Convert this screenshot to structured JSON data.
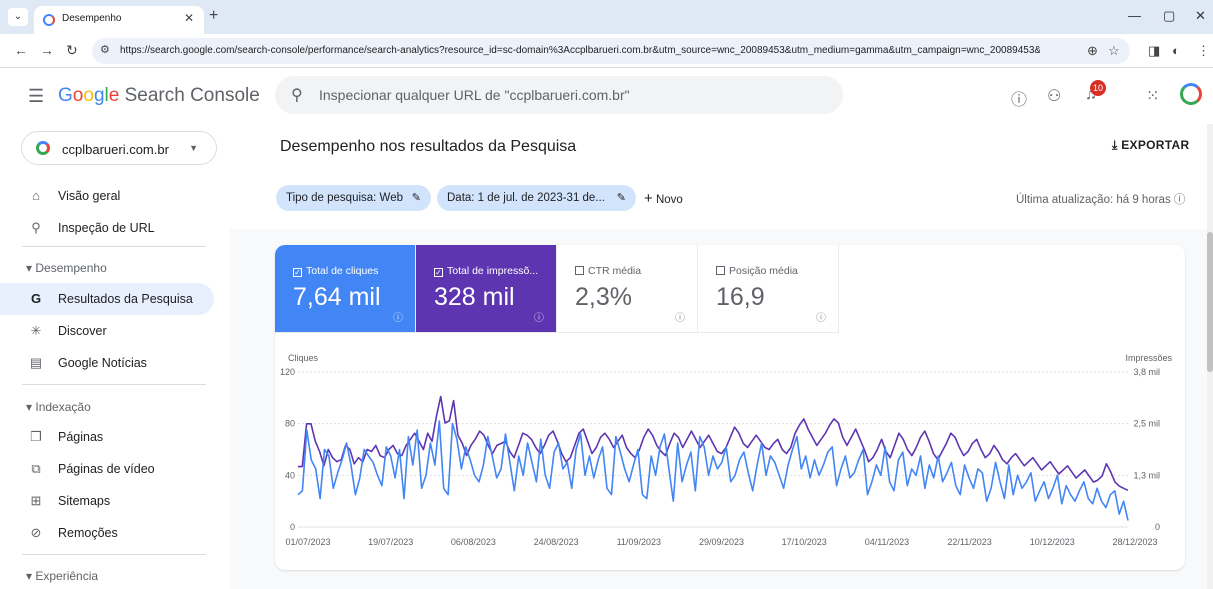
{
  "browser": {
    "tab_title": "Desempenho",
    "url": "https://search.google.com/search-console/performance/search-analytics?resource_id=sc-domain%3Accplbarueri.com.br&utm_source=wnc_20089453&utm_medium=gamma&utm_campaign=wnc_20089453&utm_co...",
    "icons": [
      "tab-list-icon",
      "close-icon",
      "plus-icon",
      "back-icon",
      "forward-icon",
      "reload-icon",
      "site-settings-icon",
      "zoom-icon",
      "star-icon",
      "sidepanel-icon",
      "extension-icon",
      "menu-icon",
      "minimize-icon",
      "maximize-icon",
      "close-window-icon"
    ]
  },
  "header": {
    "logo_google": [
      "G",
      "o",
      "o",
      "g",
      "l",
      "e"
    ],
    "logo_product": "Search Console",
    "search_placeholder": "Inspecionar qualquer URL de \"ccplbarueri.com.br\"",
    "notification_count": "10"
  },
  "sidebar": {
    "property": "ccplbarueri.com.br",
    "overview": "Visão geral",
    "url_inspection": "Inspeção de URL",
    "section_performance": "Desempenho",
    "items_performance": [
      "Resultados da Pesquisa",
      "Discover",
      "Google Notícias"
    ],
    "section_indexing": "Indexação",
    "items_indexing": [
      "Páginas",
      "Páginas de vídeo",
      "Sitemaps",
      "Remoções"
    ],
    "section_experience": "Experiência"
  },
  "main": {
    "title": "Desempenho nos resultados da Pesquisa",
    "export": "EXPORTAR",
    "filter_search_type": "Tipo de pesquisa: Web",
    "filter_date": "Data: 1 de jul. de 2023-31 de...",
    "new_filter": "Novo",
    "last_update": "Última atualização: há 9 horas"
  },
  "metrics": [
    {
      "label": "Total de cliques",
      "value": "7,64 mil",
      "selected": true,
      "color": "#4285f4"
    },
    {
      "label": "Total de impressõ...",
      "value": "328 mil",
      "selected": true,
      "color": "#5e35b1"
    },
    {
      "label": "CTR média",
      "value": "2,3%",
      "selected": false,
      "color": "#ffffff"
    },
    {
      "label": "Posição média",
      "value": "16,9",
      "selected": false,
      "color": "#ffffff"
    }
  ],
  "chart_data": {
    "type": "line",
    "ylabel_left": "Cliques",
    "ylabel_right": "Impressões",
    "yticks_left": [
      "120",
      "80",
      "40",
      "0"
    ],
    "yticks_right": [
      "3,8 mil",
      "2,5 mil",
      "1,3 mil",
      "0"
    ],
    "ylim_left": [
      0,
      120
    ],
    "ylim_right": [
      0,
      3800
    ],
    "x_tick_labels": [
      "01/07/2023",
      "19/07/2023",
      "06/08/2023",
      "24/08/2023",
      "11/09/2023",
      "29/09/2023",
      "17/10/2023",
      "04/11/2023",
      "22/11/2023",
      "10/12/2023",
      "28/12/2023"
    ],
    "grid": true,
    "series": [
      {
        "name": "Total de cliques",
        "color": "#4285f4",
        "axis": "left",
        "values": [
          25,
          28,
          75,
          52,
          45,
          22,
          60,
          55,
          30,
          42,
          52,
          65,
          48,
          25,
          38,
          60,
          55,
          50,
          40,
          32,
          62,
          55,
          38,
          60,
          22,
          70,
          48,
          75,
          30,
          40,
          65,
          48,
          82,
          30,
          25,
          80,
          68,
          45,
          62,
          52,
          40,
          35,
          48,
          70,
          55,
          38,
          45,
          72,
          50,
          28,
          55,
          40,
          65,
          50,
          35,
          68,
          40,
          30,
          58,
          65,
          45,
          50,
          30,
          60,
          72,
          40,
          55,
          38,
          52,
          62,
          30,
          25,
          70,
          58,
          45,
          35,
          48,
          60,
          25,
          22,
          55,
          40,
          62,
          72,
          45,
          20,
          65,
          35,
          48,
          58,
          28,
          70,
          62,
          40,
          55,
          45,
          50,
          62,
          35,
          40,
          52,
          58,
          42,
          28,
          48,
          65,
          40,
          55,
          50,
          40,
          30,
          48,
          60,
          70,
          45,
          55,
          38,
          52,
          40,
          48,
          58,
          62,
          32,
          45,
          55,
          38,
          42,
          52,
          60,
          25,
          35,
          48,
          40,
          62,
          35,
          28,
          52,
          58,
          32,
          45,
          40,
          55,
          30,
          48,
          38,
          55,
          35,
          42,
          50,
          32,
          25,
          48,
          38,
          30,
          45,
          42,
          20,
          30,
          50,
          35,
          22,
          48,
          25,
          40,
          30,
          35,
          42,
          20,
          28,
          35,
          22,
          30,
          40,
          18,
          32,
          25,
          20,
          28,
          35,
          22,
          18,
          30,
          20,
          15,
          25,
          28,
          10,
          20,
          5
        ]
      },
      {
        "name": "Total de impressões",
        "color": "#5e35b1",
        "axis": "right",
        "values": [
          1480,
          1480,
          2530,
          2530,
          2100,
          1850,
          1500,
          1900,
          1700,
          1600,
          1650,
          2000,
          1900,
          1550,
          1700,
          1600,
          1900,
          1850,
          2000,
          1750,
          1700,
          1900,
          2000,
          1800,
          1750,
          2000,
          2150,
          2300,
          2100,
          1900,
          2300,
          2100,
          2700,
          3200,
          2550,
          2600,
          3100,
          2250,
          2050,
          1750,
          2000,
          2150,
          2350,
          2250,
          2000,
          1800,
          2000,
          2050,
          2100,
          1850,
          1700,
          2000,
          2300,
          2250,
          2150,
          1950,
          1800,
          2000,
          2250,
          2350,
          2100,
          1800,
          1600,
          1700,
          2000,
          2300,
          2400,
          2100,
          1800,
          1950,
          2200,
          2300,
          2150,
          1950,
          2100,
          2250,
          1950,
          1800,
          1700,
          1900,
          2200,
          2400,
          2250,
          2000,
          1850,
          1750,
          2050,
          2300,
          2200,
          1950,
          2150,
          2350,
          2150,
          1950,
          2100,
          2250,
          2050,
          1850,
          1800,
          1950,
          2200,
          2450,
          2300,
          2050,
          1950,
          2100,
          2250,
          2100,
          1950,
          1900,
          2050,
          2150,
          1900,
          1800,
          1950,
          2300,
          2500,
          2650,
          2400,
          2200,
          2000,
          2150,
          2300,
          2500,
          2650,
          2550,
          2200,
          2000,
          2200,
          2400,
          2150,
          1900,
          1600,
          1700,
          1900,
          2150,
          1850,
          1700,
          2000,
          2300,
          2150,
          1900,
          1750,
          1950,
          2200,
          2350,
          2100,
          1800,
          1650,
          1850,
          2050,
          2300,
          2200,
          1950,
          1750,
          1850,
          2050,
          2150,
          1900,
          1700,
          1800,
          2000,
          1850,
          1650,
          1550,
          1700,
          1800,
          1650,
          1500,
          1600,
          1700,
          1550,
          1400,
          1500,
          1600,
          1450,
          1300,
          1400,
          1500,
          1350,
          1200,
          1300,
          1400,
          1250,
          1100,
          1150,
          1250,
          1550,
          1350,
          1100,
          1000,
          950,
          900
        ]
      }
    ]
  }
}
